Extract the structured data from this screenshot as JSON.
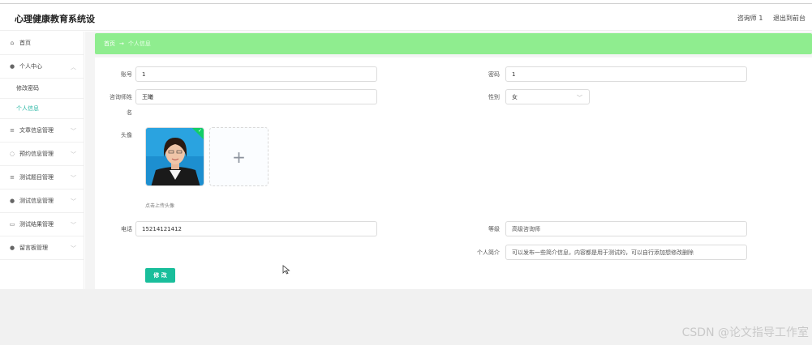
{
  "header": {
    "app_title": "心理健康教育系统设",
    "user_label": "咨询师 1",
    "logout_label": "退出到前台"
  },
  "sidebar": {
    "items": [
      {
        "label": "首页",
        "icon": "home-icon"
      },
      {
        "label": "个人中心",
        "icon": "user-icon"
      },
      {
        "label": "修改密码"
      },
      {
        "label": "个人信息"
      },
      {
        "label": "文章信息管理",
        "icon": "list-icon"
      },
      {
        "label": "预约信息管理",
        "icon": "bulb-icon"
      },
      {
        "label": "测试题目管理",
        "icon": "list-icon"
      },
      {
        "label": "测试信息管理",
        "icon": "user-icon"
      },
      {
        "label": "测试结果管理",
        "icon": "message-icon"
      },
      {
        "label": "留言板管理",
        "icon": "user-icon"
      }
    ]
  },
  "breadcrumb": {
    "home": "首页",
    "separator": "→",
    "current": "个人信息"
  },
  "form": {
    "account_label": "账号",
    "account_value": "1",
    "password_label": "密码",
    "password_value": "1",
    "name_label_line1": "咨询师姓",
    "name_label_line2": "名",
    "name_value": "王曦",
    "gender_label": "性别",
    "gender_value": "女",
    "avatar_label": "头像",
    "upload_plus": "+",
    "upload_hint": "点击上传头像",
    "phone_label": "电话",
    "phone_value": "15214121412",
    "level_label": "等级",
    "level_value": "高级咨询师",
    "intro_label": "个人简介",
    "intro_value": "可以发布一些简介信息，内容都是用于测试的，可以自行添加想修改删除",
    "save_label": "修 改"
  },
  "watermark": "CSDN @论文指导工作室",
  "colors": {
    "accent": "#19be9b",
    "breadcrumb_bg": "#8fed8f",
    "active_menu": "#2bb7a5"
  }
}
